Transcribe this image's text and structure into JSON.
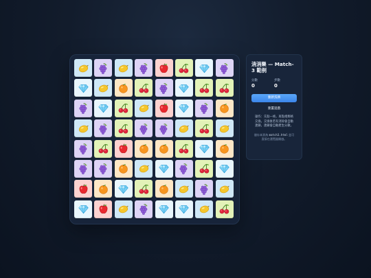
{
  "game": {
    "title": "消消樂 — Match-3 範例",
    "score_label": "分數",
    "score_value": "0",
    "moves_label": "步數",
    "moves_value": "0",
    "reshuffle_button": "重新洗牌",
    "restart_button": "重置遊戲",
    "instructions": "操作：先點一格，再點相鄰格交換。交換後若有消除會自動連鎖，連鎖會自動產生分數。",
    "hint_prefix": "儲存本頁為 ",
    "hint_file": "match3.html",
    "hint_suffix": " 並可直接在瀏覽器開啟。"
  },
  "board": {
    "rows": 8,
    "cols": 8,
    "grid": [
      [
        "lemon",
        "grape",
        "lemon",
        "grape",
        "apple",
        "cherry",
        "gem",
        "grape"
      ],
      [
        "gem",
        "lemon",
        "orange",
        "cherry",
        "grape",
        "gem",
        "cherry",
        "cherry"
      ],
      [
        "grape",
        "gem",
        "cherry",
        "lemon",
        "apple",
        "gem",
        "grape",
        "orange"
      ],
      [
        "lemon",
        "grape",
        "cherry",
        "grape",
        "grape",
        "lemon",
        "cherry",
        "lemon"
      ],
      [
        "grape",
        "cherry",
        "apple",
        "orange",
        "orange",
        "cherry",
        "gem",
        "orange"
      ],
      [
        "grape",
        "grape",
        "orange",
        "lemon",
        "gem",
        "grape",
        "cherry",
        "gem"
      ],
      [
        "apple",
        "orange",
        "gem",
        "cherry",
        "orange",
        "lemon",
        "grape",
        "lemon"
      ],
      [
        "gem",
        "apple",
        "lemon",
        "grape",
        "gem",
        "gem",
        "lemon",
        "cherry"
      ]
    ]
  },
  "colors": {
    "accent": "#4a95f2",
    "background": "#0f1827",
    "panel": "#18253a",
    "tile_lemon": "#cfe8f7",
    "tile_grape": "#ddd4f6",
    "tile_cherry": "#e3f2b8",
    "tile_orange": "#fde7c6",
    "tile_apple": "#fcd2d0",
    "tile_gem": "#e9f6fd"
  }
}
